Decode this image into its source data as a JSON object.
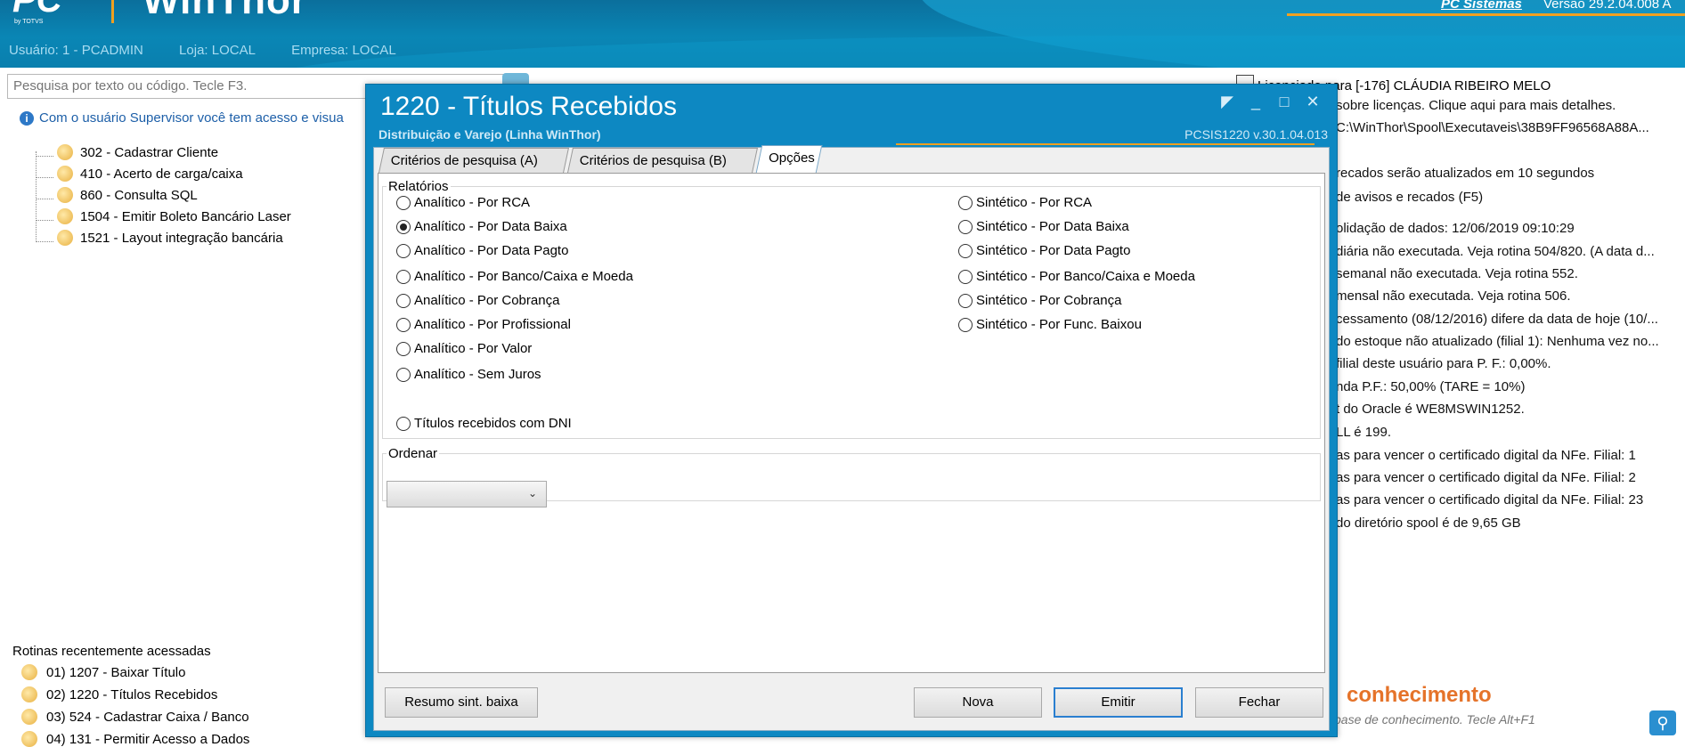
{
  "header": {
    "logo_text": "PC",
    "logo_subtext": "by TOTVS",
    "app_name": "WinThor",
    "company_link": "PC Sistemas",
    "version": "Versão 29.2.04.008 A",
    "user": "Usuário: 1 - PCADMIN",
    "store": "Loja: LOCAL",
    "enterprise": "Empresa: LOCAL",
    "colors": {
      "banner": "#0a86b5",
      "accent": "#f0a020"
    }
  },
  "left": {
    "search_placeholder": "Pesquisa por texto ou código. Tecle F3.",
    "notice": "Com o usuário Supervisor você tem acesso e visua",
    "tree": [
      "302 - Cadastrar Cliente",
      "410 - Acerto de carga/caixa",
      "860 - Consulta SQL",
      "1504 - Emitir Boleto Bancário Laser",
      "1521 - Layout integração bancária"
    ],
    "recent_title": "Rotinas recentemente acessadas",
    "recent": [
      "01)  1207 - Baixar Título",
      "02)  1220 - Títulos Recebidos",
      "03)  524 - Cadastrar Caixa / Banco",
      "04)  131 - Permitir Acesso a Dados"
    ]
  },
  "right": {
    "licensed": "Licenciado para [-176] CLÁUDIA RIBEIRO MELO",
    "lines": [
      "sobre licenças. Clique aqui para mais detalhes.",
      "C:\\WinThor\\Spool\\Executaveis\\38B9FF96568A88A...",
      "recados serão atualizados em 10 segundos",
      "de avisos e recados (F5)",
      "olidação de dados: 12/06/2019 09:10:29",
      "diária não executada. Veja rotina 504/820. (A data d...",
      "semanal não executada. Veja rotina 552.",
      "mensal não executada. Veja rotina 506.",
      "cessamento (08/12/2016) difere da data de hoje (10/...",
      "do estoque não atualizado (filial 1): Nenhuma vez no...",
      "filial deste usuário para P. F.: 0,00%.",
      "nda P.F.: 50,00% (TARE = 10%)",
      "t do Oracle é WE8MSWIN1252.",
      "LL é 199.",
      "as para vencer o certificado digital da NFe. Filial: 1",
      "as para vencer o certificado digital da NFe. Filial: 2",
      "as para vencer o certificado digital da NFe. Filial: 23",
      "do diretório spool é de 9,65 GB"
    ],
    "kb_title": "conhecimento",
    "kb_placeholder": "base de conhecimento. Tecle Alt+F1"
  },
  "dialog": {
    "title": "1220 - Títulos Recebidos",
    "subtitle": "Distribuição e Varejo (Linha WinThor)",
    "code": "PCSIS1220  v.30.1.04.013",
    "tabs": [
      "Critérios de pesquisa (A)",
      "Critérios de pesquisa (B)",
      "Opções"
    ],
    "active_tab": "Opções",
    "relatorios_label": "Relatórios",
    "analitico": [
      "Analítico - Por RCA",
      "Analítico - Por Data Baixa",
      "Analítico - Por Data Pagto",
      "Analítico - Por Banco/Caixa e Moeda",
      "Analítico - Por Cobrança",
      "Analítico - Por Profissional",
      "Analítico - Por Valor",
      "Analítico - Sem Juros"
    ],
    "sintetico": [
      "Sintético - Por RCA",
      "Sintético - Por Data Baixa",
      "Sintético - Por Data Pagto",
      "Sintético - Por Banco/Caixa e Moeda",
      "Sintético - Por Cobrança",
      "Sintético - Por Func. Baixou"
    ],
    "selected": "Analítico - Por Data Baixa",
    "dni_option": "Títulos recebidos com DNI",
    "ordenar_label": "Ordenar",
    "ordenar_value": "",
    "buttons": {
      "resumo": "Resumo sint. baixa",
      "nova": "Nova",
      "emitir": "Emitir",
      "fechar": "Fechar"
    }
  }
}
